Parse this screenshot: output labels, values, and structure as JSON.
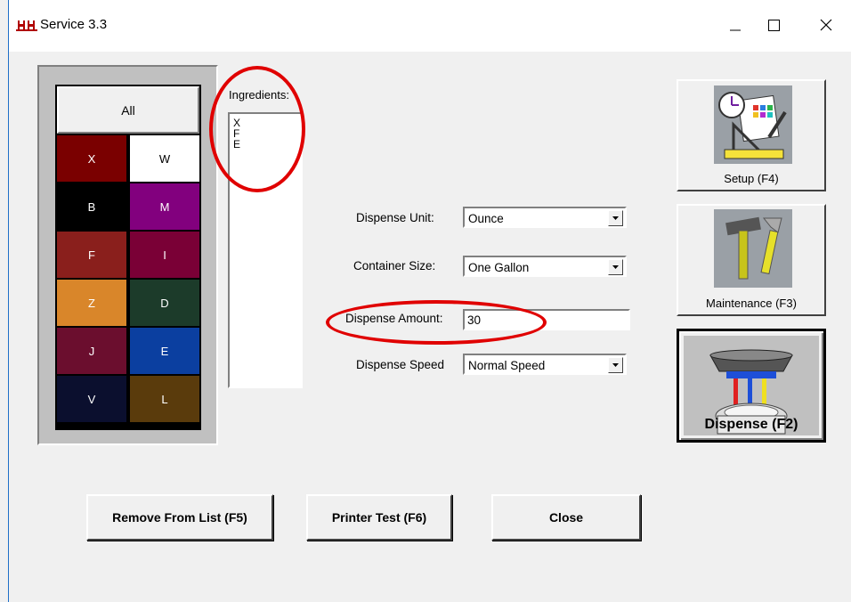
{
  "window": {
    "title": "Service 3.3"
  },
  "colors": {
    "all_label": "All",
    "swatches": [
      {
        "label": "X",
        "color": "#7a0000",
        "text": "#ffffff"
      },
      {
        "label": "W",
        "color": "#ffffff",
        "text": "#000000"
      },
      {
        "label": "B",
        "color": "#000000",
        "text": "#ffffff"
      },
      {
        "label": "M",
        "color": "#82007e",
        "text": "#ffffff"
      },
      {
        "label": "F",
        "color": "#8a1f1c",
        "text": "#ffffff"
      },
      {
        "label": "I",
        "color": "#7a0036",
        "text": "#ffffff"
      },
      {
        "label": "Z",
        "color": "#d9862a",
        "text": "#ffffff"
      },
      {
        "label": "D",
        "color": "#1c3b2a",
        "text": "#ffffff"
      },
      {
        "label": "J",
        "color": "#6b0e2e",
        "text": "#ffffff"
      },
      {
        "label": "E",
        "color": "#0b3fa0",
        "text": "#ffffff"
      },
      {
        "label": "V",
        "color": "#0b0f2e",
        "text": "#ffffff"
      },
      {
        "label": "L",
        "color": "#5a3b0c",
        "text": "#ffffff"
      }
    ]
  },
  "ingredients": {
    "label": "Ingredients:",
    "items": [
      "X",
      "F",
      "E"
    ]
  },
  "form": {
    "dispense_unit": {
      "label": "Dispense Unit:",
      "value": "Ounce"
    },
    "container_size": {
      "label": "Container Size:",
      "value": "One Gallon"
    },
    "dispense_amount": {
      "label": "Dispense Amount:",
      "value": "30"
    },
    "dispense_speed": {
      "label": "Dispense Speed",
      "value": "Normal Speed"
    }
  },
  "side_buttons": {
    "setup": "Setup (F4)",
    "maintenance": "Maintenance (F3)",
    "dispense": "Dispense (F2)"
  },
  "bottom_buttons": {
    "remove": "Remove From List (F5)",
    "printer_test": "Printer Test (F6)",
    "close": "Close"
  },
  "accent": {
    "annotation_red": "#e00000",
    "window_border": "#1e6fc8"
  }
}
